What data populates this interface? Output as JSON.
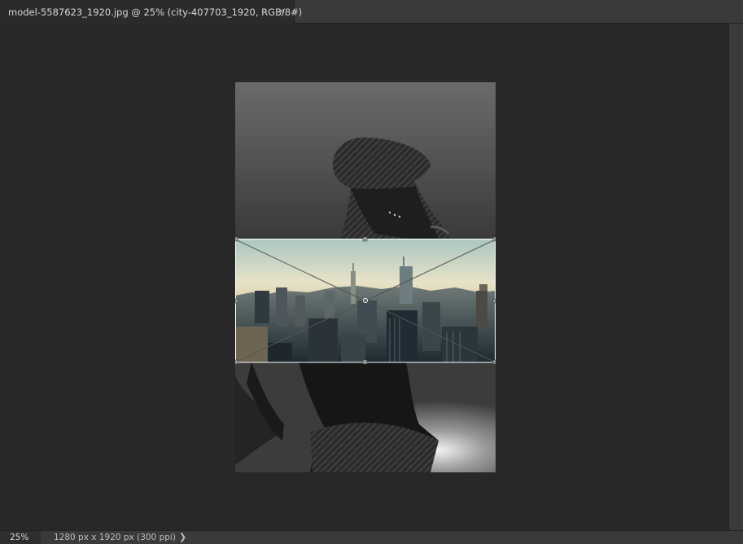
{
  "tab": {
    "title": "model-5587623_1920.jpg @ 25% (city-407703_1920, RGB/8#)",
    "close": "×"
  },
  "status": {
    "zoom": "25%",
    "doc_info": "1280 px x 1920 px (300 ppi)",
    "arrow": "❯"
  },
  "colors": {
    "workspace": "#282828",
    "panel": "#3a3a3a",
    "transform_box": "#ffffff",
    "handle": "#9a9a9a"
  }
}
